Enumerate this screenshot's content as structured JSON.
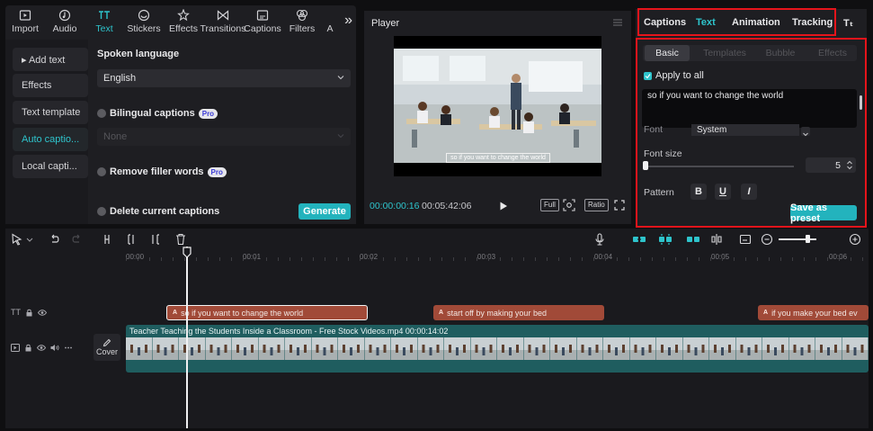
{
  "toolbar": {
    "tools": [
      {
        "label": "Import",
        "icon": "import-icon"
      },
      {
        "label": "Audio",
        "icon": "audio-icon"
      },
      {
        "label": "Text",
        "icon": "text-icon",
        "active": true
      },
      {
        "label": "Stickers",
        "icon": "stickers-icon"
      },
      {
        "label": "Effects",
        "icon": "effects-icon"
      },
      {
        "label": "Transitions",
        "icon": "transitions-icon"
      },
      {
        "label": "Captions",
        "icon": "captions-icon"
      },
      {
        "label": "Filters",
        "icon": "filters-icon"
      },
      {
        "label": "A",
        "icon": "adjust-icon"
      }
    ],
    "more": "»"
  },
  "sidebar": {
    "items": [
      {
        "label": "▸ Add text"
      },
      {
        "label": "Effects"
      },
      {
        "label": "Text template"
      },
      {
        "label": "Auto captio...",
        "active": true
      },
      {
        "label": "Local capti..."
      }
    ]
  },
  "captions_panel": {
    "spoken_language_label": "Spoken language",
    "spoken_language_value": "English",
    "bilingual_label": "Bilingual captions",
    "bilingual_badge": "Pro",
    "bilingual_value": "None",
    "remove_filler_label": "Remove filler words",
    "remove_filler_badge": "Pro",
    "delete_current_label": "Delete current captions",
    "generate_label": "Generate"
  },
  "player": {
    "title": "Player",
    "subtitle_overlay": "so if you want to change the world",
    "current_time": "00:00:00:16",
    "duration": "00:05:42:06",
    "full_label": "Full",
    "ratio_label": "Ratio"
  },
  "inspector": {
    "tabs": [
      {
        "label": "Captions"
      },
      {
        "label": "Text",
        "active": true
      },
      {
        "label": "Animation"
      },
      {
        "label": "Tracking"
      },
      {
        "label": "Tₜ"
      }
    ],
    "subtabs": [
      {
        "label": "Basic",
        "active": true
      },
      {
        "label": "Templates"
      },
      {
        "label": "Bubble"
      },
      {
        "label": "Effects"
      }
    ],
    "apply_to_all": "Apply to all",
    "text_value": "so if you want to change the world",
    "font_label": "Font",
    "font_value": "System",
    "font_size_label": "Font size",
    "font_size_value": "5",
    "font_size_fraction": 0.0,
    "pattern_label": "Pattern",
    "bold": "B",
    "underline": "U",
    "italic": "I",
    "save_preset": "Save as preset"
  },
  "timeline": {
    "ruler": [
      "00:00",
      "00:01",
      "00:02",
      "00:03",
      "00:04",
      "00:05",
      "00:06"
    ],
    "text_track_label": "TT",
    "text_clips": [
      {
        "text": "so if you want to change the world",
        "selected": true
      },
      {
        "text": "start off by making your bed"
      },
      {
        "text": "if you make your bed ev"
      }
    ],
    "text_clip_badge": "A",
    "video_clip_title": "Teacher Teaching the Students Inside a Classroom - Free Stock Videos.mp4  00:00:14:02",
    "cover_label": "Cover",
    "zoom_fraction": 0.72
  },
  "colors": {
    "accent": "#2ec4cc",
    "button": "#23b3bd",
    "highlight_box": "#e5141b",
    "text_clip": "#a14a38",
    "video_clip": "#1f5d5f"
  }
}
